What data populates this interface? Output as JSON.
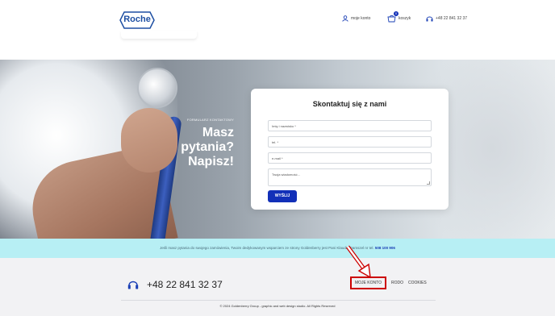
{
  "header": {
    "logo_text": "Roche",
    "nav": {
      "account_label": "moje konto",
      "cart_label": "koszyk",
      "cart_count": "0",
      "phone_label": "+48 22 841 32 37"
    }
  },
  "hero": {
    "eyebrow": "FORMULARZ KONTAKTOWY",
    "title_line1": "Masz",
    "title_line2": "pytania?",
    "title_line3": "Napisz!"
  },
  "contact_form": {
    "title": "Skontaktuj się z nami",
    "name_placeholder": "Imię i nazwisko *",
    "phone_placeholder": "tel. *",
    "email_placeholder": "e-mail *",
    "message_placeholder": "Twoja wiadomość...",
    "submit_label": "WYŚLIJ"
  },
  "notice": {
    "text": "Jeśli masz pytania do swojego zamówienia, Twoim dedykowanym wsparciem ze strony Goldenberry jest Pani Klaudia Damszel nr tel.",
    "phone": "508 100 906"
  },
  "footer": {
    "phone": "+48 22 841 32 37",
    "links": [
      "MOJE KONTO",
      "RODO",
      "COOKIES"
    ],
    "copyright": "© 2024 Goldenberry Group - graphic and web design studio. All Rights Reserved"
  },
  "colors": {
    "brand_blue": "#1230b8",
    "notice_bg": "#b7eff4",
    "highlight_red": "#cc0000"
  },
  "icons": {
    "account": "user-icon",
    "cart": "cart-icon",
    "phone": "headset-icon"
  }
}
